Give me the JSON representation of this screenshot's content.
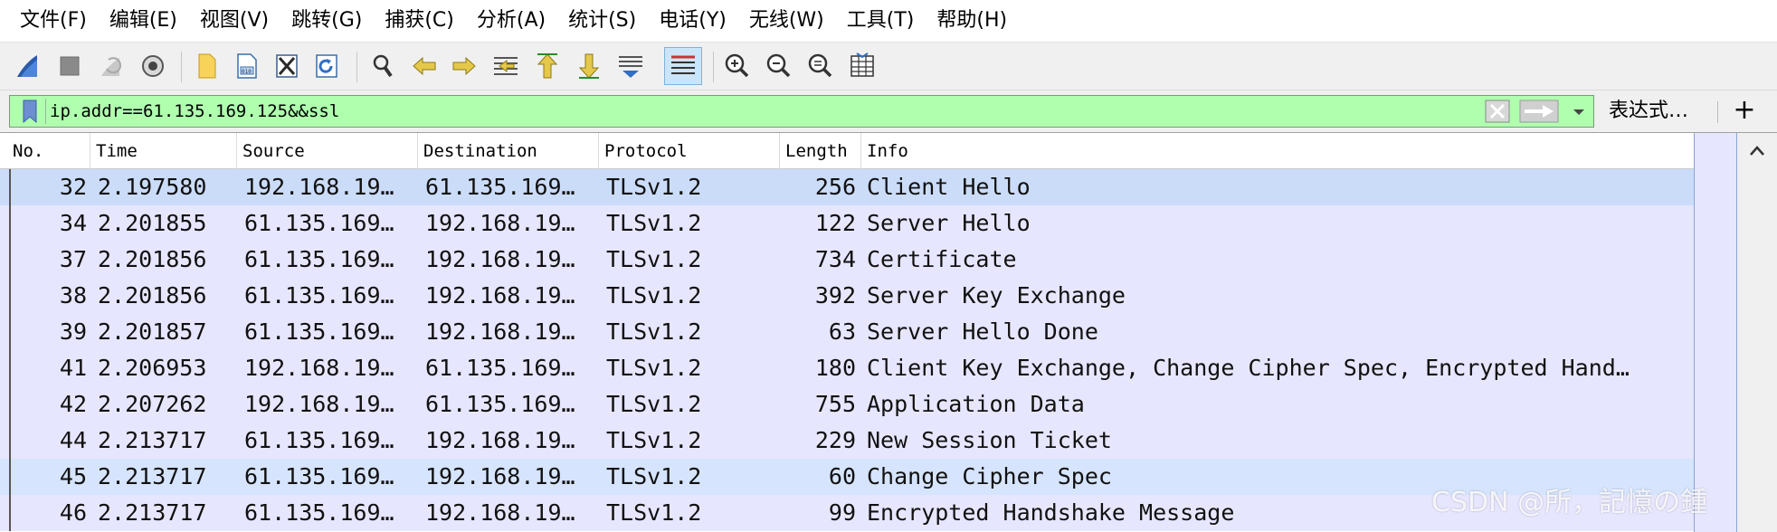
{
  "menu": [
    {
      "label": "文件(F)"
    },
    {
      "label": "编辑(E)"
    },
    {
      "label": "视图(V)"
    },
    {
      "label": "跳转(G)"
    },
    {
      "label": "捕获(C)"
    },
    {
      "label": "分析(A)"
    },
    {
      "label": "统计(S)"
    },
    {
      "label": "电话(Y)"
    },
    {
      "label": "无线(W)"
    },
    {
      "label": "工具(T)"
    },
    {
      "label": "帮助(H)"
    }
  ],
  "toolbar": {
    "buttons": [
      "shark-fin-start-icon",
      "stop-icon",
      "restart-icon",
      "capture-options-icon",
      "open-file-icon",
      "save-file-icon",
      "close-file-icon",
      "reload-icon",
      "find-packet-icon",
      "go-back-icon",
      "go-forward-icon",
      "go-to-packet-icon",
      "first-packet-icon",
      "last-packet-icon",
      "autoscroll-icon",
      "colorize-icon",
      "zoom-in-icon",
      "zoom-out-icon",
      "normal-size-icon",
      "resize-columns-icon"
    ]
  },
  "filter": {
    "value": "ip.addr==61.135.169.125&&ssl",
    "expression_label": "表达式…",
    "add_label": "+"
  },
  "columns": [
    "No.",
    "Time",
    "Source",
    "Destination",
    "Protocol",
    "Length",
    "Info"
  ],
  "packets": [
    {
      "no": "32",
      "time": "2.197580",
      "src": "192.168.19…",
      "dst": "61.135.169…",
      "proto": "TLSv1.2",
      "len": "256",
      "info": "Client Hello"
    },
    {
      "no": "34",
      "time": "2.201855",
      "src": "61.135.169…",
      "dst": "192.168.19…",
      "proto": "TLSv1.2",
      "len": "122",
      "info": "Server Hello"
    },
    {
      "no": "37",
      "time": "2.201856",
      "src": "61.135.169…",
      "dst": "192.168.19…",
      "proto": "TLSv1.2",
      "len": "734",
      "info": "Certificate"
    },
    {
      "no": "38",
      "time": "2.201856",
      "src": "61.135.169…",
      "dst": "192.168.19…",
      "proto": "TLSv1.2",
      "len": "392",
      "info": "Server Key Exchange"
    },
    {
      "no": "39",
      "time": "2.201857",
      "src": "61.135.169…",
      "dst": "192.168.19…",
      "proto": "TLSv1.2",
      "len": "63",
      "info": "Server Hello Done"
    },
    {
      "no": "41",
      "time": "2.206953",
      "src": "192.168.19…",
      "dst": "61.135.169…",
      "proto": "TLSv1.2",
      "len": "180",
      "info": "Client Key Exchange, Change Cipher Spec, Encrypted Hand…"
    },
    {
      "no": "42",
      "time": "2.207262",
      "src": "192.168.19…",
      "dst": "61.135.169…",
      "proto": "TLSv1.2",
      "len": "755",
      "info": "Application Data"
    },
    {
      "no": "44",
      "time": "2.213717",
      "src": "61.135.169…",
      "dst": "192.168.19…",
      "proto": "TLSv1.2",
      "len": "229",
      "info": "New Session Ticket"
    },
    {
      "no": "45",
      "time": "2.213717",
      "src": "61.135.169…",
      "dst": "192.168.19…",
      "proto": "TLSv1.2",
      "len": "60",
      "info": "Change Cipher Spec"
    },
    {
      "no": "46",
      "time": "2.213717",
      "src": "61.135.169…",
      "dst": "192.168.19…",
      "proto": "TLSv1.2",
      "len": "99",
      "info": "Encrypted Handshake Message"
    }
  ],
  "colors": {
    "filter_valid": "#afffaf",
    "row_tcp": "#e7e6ff",
    "row_selected": "#cbdcf9"
  },
  "watermark": "CSDN @所，記憶の鍾"
}
